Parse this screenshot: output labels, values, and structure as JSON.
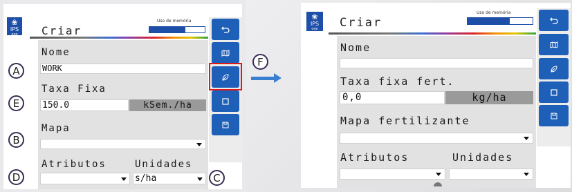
{
  "left": {
    "logo": {
      "text": "IPS",
      "sub": "ooo"
    },
    "title": "Criar",
    "memory_label": "Uso de memória",
    "memory_fill": 0.65,
    "fields": {
      "nome_label": "Nome",
      "nome_value": "WORK",
      "taxa_label": "Taxa Fixa",
      "taxa_value": "150.0",
      "taxa_unit": "kSem./ha",
      "mapa_label": "Mapa",
      "mapa_value": "",
      "atributos_label": "Atributos",
      "atributos_value": "",
      "unidades_label": "Unidades",
      "unidades_value": "s/ha"
    }
  },
  "right": {
    "logo": {
      "text": "IPS",
      "sub": "ooo"
    },
    "title": "Criar",
    "memory_label": "Uso de memória",
    "memory_fill": 0.65,
    "fields": {
      "nome_label": "Nome",
      "nome_value": "",
      "taxa_label": "Taxa fixa fert.",
      "taxa_value": "0,0",
      "taxa_unit": "kg/ha",
      "mapa_label": "Mapa fertilizante",
      "mapa_value": "",
      "atributos_label": "Atributos",
      "atributos_value": "",
      "unidades_label": "Unidades",
      "unidades_value": ""
    }
  },
  "sidebar_icons": [
    "back-icon",
    "map-icon",
    "leaf-icon",
    "square-icon",
    "save-icon"
  ],
  "callouts": {
    "a": "A",
    "b": "B",
    "c": "C",
    "d": "D",
    "e": "E",
    "f": "F"
  },
  "colors": {
    "accent": "#1e5fb8",
    "highlight": "#e01818",
    "arrow": "#3a7fd0"
  }
}
